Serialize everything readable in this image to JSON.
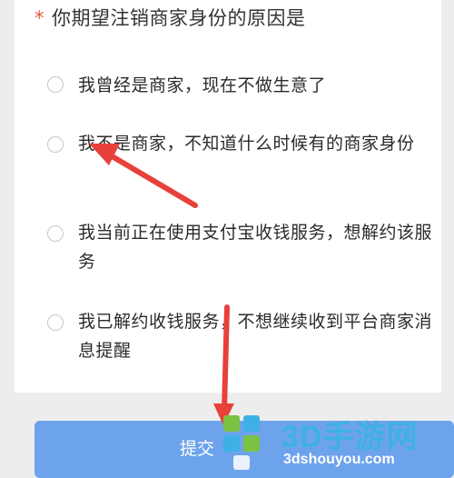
{
  "form": {
    "required_mark": "*",
    "question": "你期望注销商家身份的原因是",
    "options": [
      {
        "label": "我曾经是商家，现在不做生意了"
      },
      {
        "label": "我不是商家，不知道什么时候有的商家身份"
      },
      {
        "label": "我当前正在使用支付宝收钱服务，想解约该服务"
      },
      {
        "label": "我已解约收钱服务，不想继续收到平台商家消息提醒"
      }
    ],
    "submit_label": "提交"
  },
  "watermark": {
    "brand": "3D手游网",
    "url": "3dshouyou.com"
  },
  "colors": {
    "accent_button": "#6da3ec",
    "required": "#e8553c",
    "annotation_arrow": "#e8403a",
    "watermark": "#3fb0e5"
  }
}
